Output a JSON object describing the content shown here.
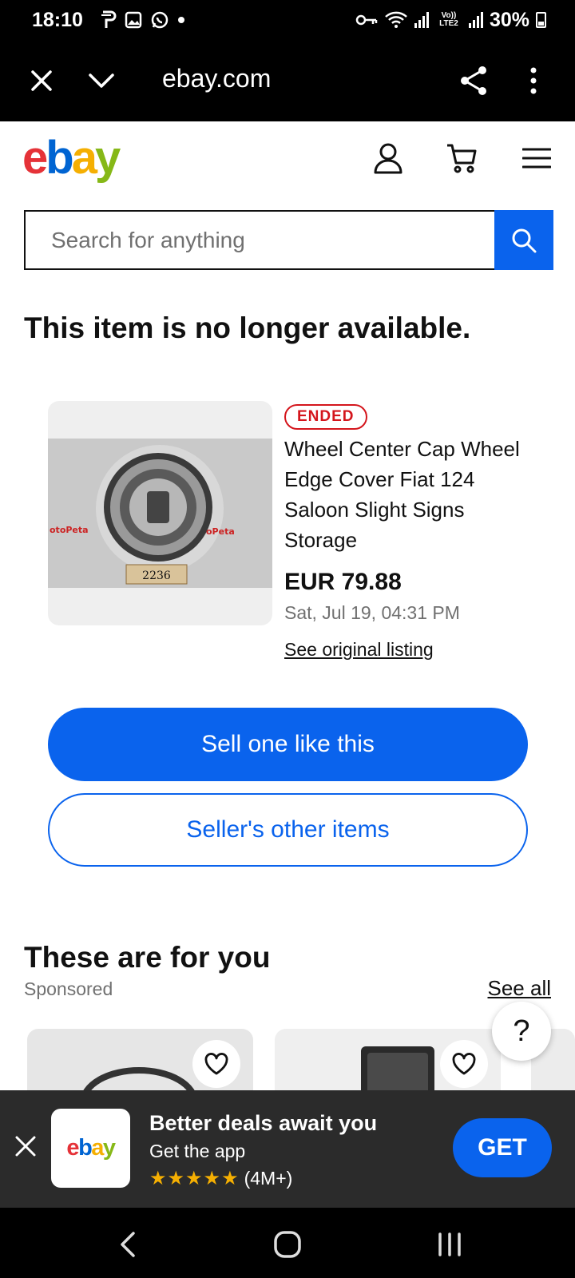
{
  "status_bar": {
    "time": "18:10",
    "battery": "30%",
    "network_label": "Vo)) LTE2"
  },
  "browser": {
    "url": "ebay.com"
  },
  "search": {
    "placeholder": "Search for anything"
  },
  "page": {
    "unavailable_message": "This item is no longer available."
  },
  "listing": {
    "status_badge": "ENDED",
    "title": "Wheel Center Cap Wheel Edge Cover Fiat 124 Saloon Slight Signs Storage",
    "price": "EUR 79.88",
    "ended_date": "Sat, Jul 19, 04:31 PM",
    "original_link": "See original listing",
    "image_tag": "2236"
  },
  "actions": {
    "sell_label": "Sell one like this",
    "seller_items_label": "Seller's other items"
  },
  "recommendations": {
    "heading": "These are for you",
    "sponsored_label": "Sponsored",
    "see_all_label": "See all",
    "help_label": "?"
  },
  "app_banner": {
    "logo_text": "ebay",
    "title": "Better deals await you",
    "subtitle": "Get the app",
    "stars": "★★★★★",
    "rating_count": "(4M+)",
    "get_label": "GET"
  },
  "colors": {
    "accent_blue": "#0a63ed",
    "ended_red": "#d4151c",
    "banner_bg": "#2b2b2b",
    "star_gold": "#f5af02"
  }
}
